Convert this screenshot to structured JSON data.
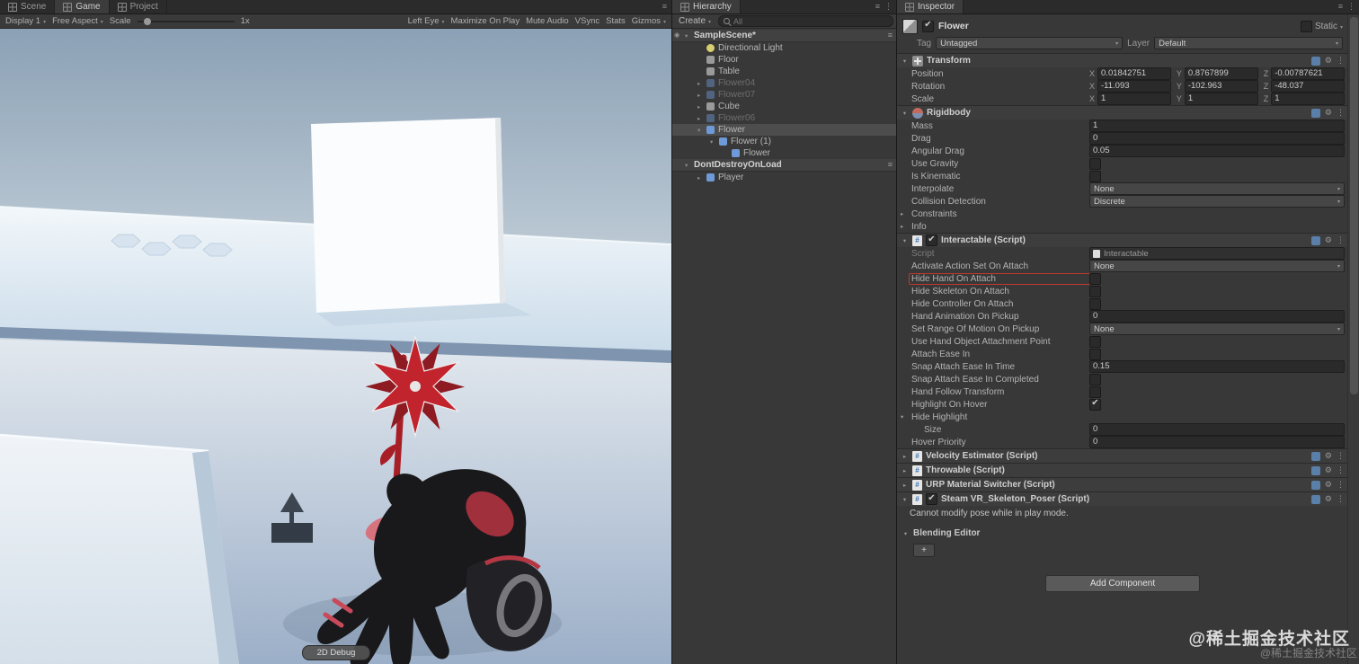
{
  "game": {
    "tabs": [
      {
        "label": "Scene",
        "active": false
      },
      {
        "label": "Game",
        "active": true
      },
      {
        "label": "Project",
        "active": false
      }
    ],
    "toolbar": {
      "display": "Display 1",
      "aspect": "Free Aspect",
      "scale_label": "Scale",
      "scale_value": "1x",
      "eye": "Left Eye",
      "maximize": "Maximize On Play",
      "mute": "Mute Audio",
      "vsync": "VSync",
      "stats": "Stats",
      "gizmos": "Gizmos"
    },
    "debug_button": "2D Debug"
  },
  "hierarchy": {
    "title": "Hierarchy",
    "create_label": "Create",
    "search_hint": "All",
    "items": [
      {
        "label": "SampleScene*",
        "depth": 0,
        "scene": true,
        "arrow": "▾",
        "eye": true
      },
      {
        "label": "Directional Light",
        "depth": 1,
        "icon": "light"
      },
      {
        "label": "Floor",
        "depth": 1,
        "icon": "cube"
      },
      {
        "label": "Table",
        "depth": 1,
        "icon": "cube"
      },
      {
        "label": "Flower04",
        "depth": 1,
        "icon": "prefab",
        "dim": true,
        "arrow": "▸"
      },
      {
        "label": "Flower07",
        "depth": 1,
        "icon": "prefab",
        "dim": true,
        "arrow": "▸"
      },
      {
        "label": "Cube",
        "depth": 1,
        "icon": "cube",
        "arrow": "▸"
      },
      {
        "label": "Flower06",
        "depth": 1,
        "icon": "prefab",
        "dim": true,
        "arrow": "▸"
      },
      {
        "label": "Flower",
        "depth": 1,
        "icon": "prefab",
        "selected": true,
        "arrow": "▾"
      },
      {
        "label": "Flower (1)",
        "depth": 2,
        "icon": "prefab",
        "arrow": "▾"
      },
      {
        "label": "Flower",
        "depth": 3,
        "icon": "prefab"
      },
      {
        "label": "DontDestroyOnLoad",
        "depth": 0,
        "scene": true,
        "arrow": "▾"
      },
      {
        "label": "Player",
        "depth": 1,
        "icon": "prefab",
        "arrow": "▸"
      }
    ]
  },
  "inspector": {
    "title": "Inspector",
    "object": {
      "name": "Flower",
      "static_label": "Static"
    },
    "tag_row": {
      "tag_label": "Tag",
      "tag_value": "Untagged",
      "layer_label": "Layer",
      "layer_value": "Default"
    },
    "axis_labels": {
      "x": "X",
      "y": "Y",
      "z": "Z"
    },
    "transform": {
      "title": "Transform",
      "rows": [
        {
          "label": "Position",
          "x": "0.01842751",
          "y": "0.8767899",
          "z": "-0.00787621"
        },
        {
          "label": "Rotation",
          "x": "-11.093",
          "y": "-102.963",
          "z": "-48.037"
        },
        {
          "label": "Scale",
          "x": "1",
          "y": "1",
          "z": "1"
        }
      ]
    },
    "rigidbody": {
      "title": "Rigidbody",
      "rows": [
        {
          "label": "Mass",
          "is_field": true,
          "value": "1"
        },
        {
          "label": "Drag",
          "is_field": true,
          "value": "0"
        },
        {
          "label": "Angular Drag",
          "is_field": true,
          "value": "0.05"
        },
        {
          "label": "Use Gravity",
          "is_check": true
        },
        {
          "label": "Is Kinematic",
          "is_check": true
        },
        {
          "label": "Interpolate",
          "is_drop": true,
          "value": "None"
        },
        {
          "label": "Collision Detection",
          "is_drop": true,
          "value": "Discrete"
        },
        {
          "label": "Constraints",
          "fold": "▸"
        },
        {
          "label": "Info",
          "fold": "▸"
        }
      ]
    },
    "interactable": {
      "title": "Interactable (Script)",
      "rows": [
        {
          "label": "Script",
          "dim": true,
          "is_obj": true,
          "value": "Interactable"
        },
        {
          "label": "Activate Action Set On Attach",
          "is_drop": true,
          "value": "None"
        },
        {
          "label": "Hide Hand On Attach",
          "is_check": true,
          "highlight": true
        },
        {
          "label": "Hide Skeleton On Attach",
          "is_check": true
        },
        {
          "label": "Hide Controller On Attach",
          "is_check": true
        },
        {
          "label": "Hand Animation On Pickup",
          "is_field": true,
          "value": "0"
        },
        {
          "label": "Set Range Of Motion On Pickup",
          "is_drop": true,
          "value": "None"
        },
        {
          "label": "Use Hand Object Attachment Point",
          "is_check": true
        },
        {
          "label": "Attach Ease In",
          "is_check": true
        },
        {
          "label": "Snap Attach Ease In Time",
          "is_field": true,
          "value": "0.15"
        },
        {
          "label": "Snap Attach Ease In Completed",
          "is_check": true
        },
        {
          "label": "Hand Follow Transform",
          "is_check": true
        },
        {
          "label": "Highlight On Hover",
          "is_check": true,
          "checked": true
        },
        {
          "label": "Hide Highlight",
          "fold": "▾"
        },
        {
          "label": "Size",
          "is_field": true,
          "value": "0",
          "indent": true
        },
        {
          "label": "Hover Priority",
          "is_field": true,
          "value": "0"
        }
      ]
    },
    "collapsed_components": [
      {
        "title": "Velocity Estimator (Script)"
      },
      {
        "title": "Throwable (Script)"
      },
      {
        "title": "URP Material Switcher (Script)"
      }
    ],
    "skeleton_poser": {
      "title": "Steam VR_Skeleton_Poser (Script)",
      "message": "Cannot modify pose while in play mode.",
      "blending_label": "Blending Editor",
      "add_label": "+"
    },
    "add_component_label": "Add Component"
  },
  "watermark": {
    "text": "@稀土掘金技术社区",
    "text2": "@稀土掘金技术社区"
  }
}
